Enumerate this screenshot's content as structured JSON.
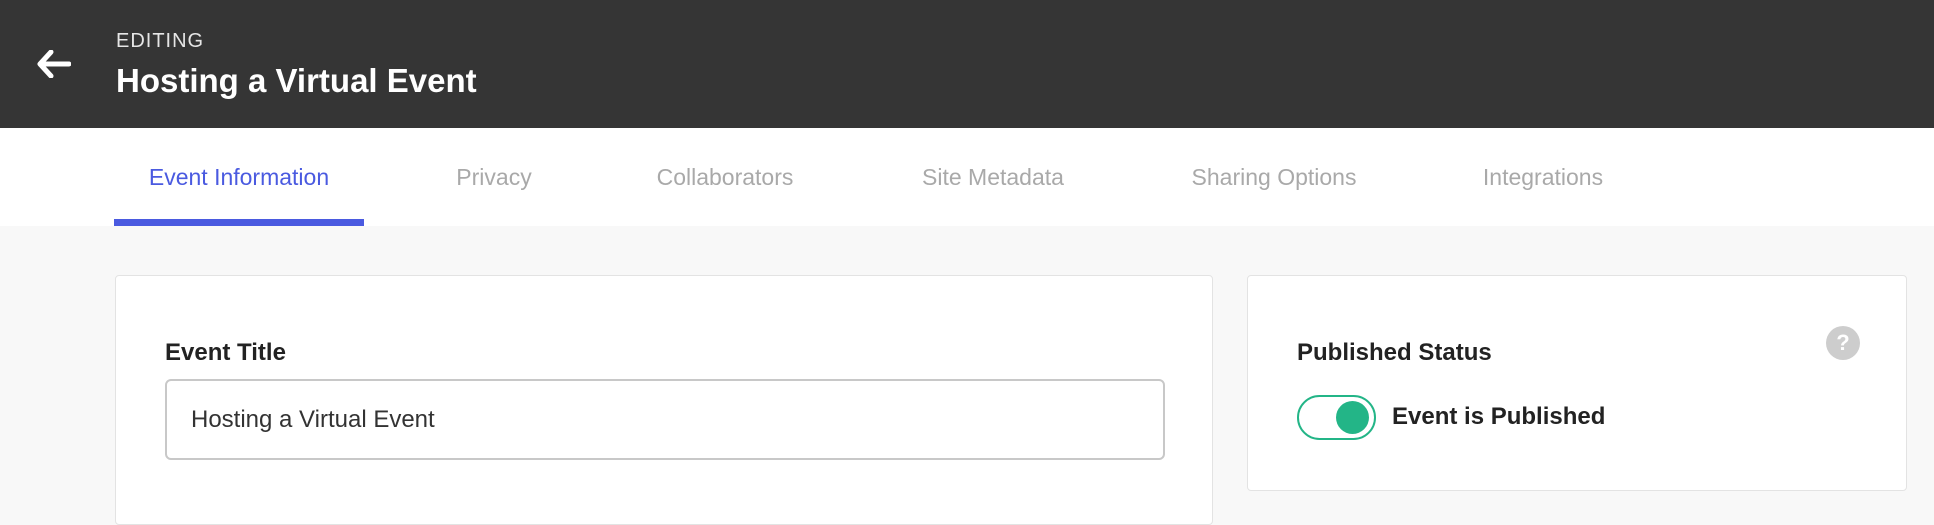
{
  "header": {
    "back_icon": "arrow-left-icon",
    "editing_label": "EDITING",
    "title": "Hosting a Virtual Event",
    "background_color": "#353535"
  },
  "tabs": [
    {
      "label": "Event Information",
      "active": true
    },
    {
      "label": "Privacy",
      "active": false
    },
    {
      "label": "Collaborators",
      "active": false
    },
    {
      "label": "Site Metadata",
      "active": false
    },
    {
      "label": "Sharing Options",
      "active": false
    },
    {
      "label": "Integrations",
      "active": false
    }
  ],
  "event_title_card": {
    "label": "Event Title",
    "input_value": "Hosting a Virtual Event"
  },
  "published_card": {
    "label": "Published Status",
    "help_icon": "question-circle-icon",
    "toggle_on": true,
    "toggle_label": "Event is Published"
  },
  "colors": {
    "accent": "#4a5ae0",
    "toggle_on": "#23b587",
    "inactive_tab": "#a9a9a9"
  }
}
